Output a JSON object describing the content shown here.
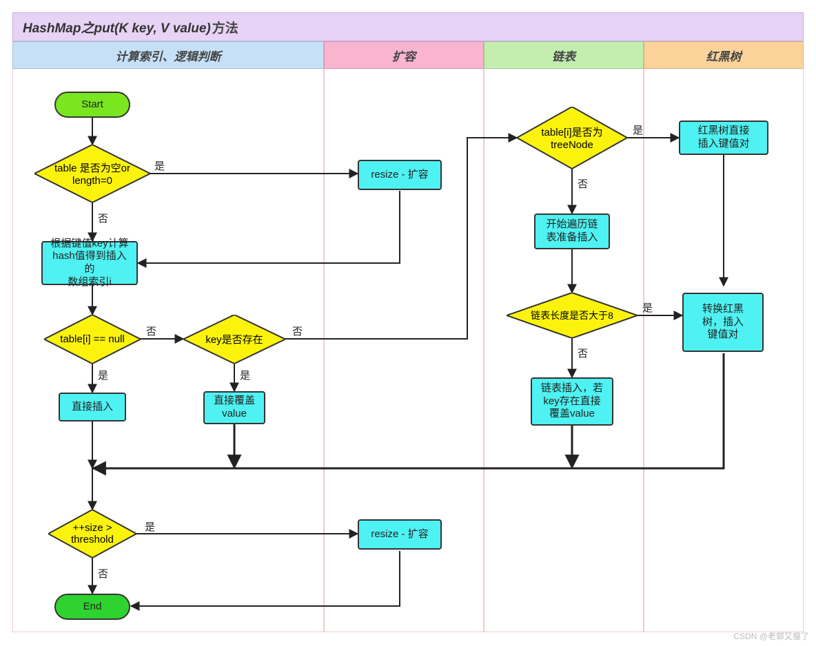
{
  "title_italic": "HashMap之put(K key, V value)",
  "title_rest": "方法",
  "lanes": {
    "l1": "计算索引、逻辑判断",
    "l2": "扩容",
    "l3": "链表",
    "l4": "红黑树"
  },
  "nodes": {
    "start": "Start",
    "end": "End",
    "d_table_empty": "table 是否为空or\nlength=0",
    "p_calc_hash": "根据键值key计算\nhash值得到插入的\n数组索引i",
    "d_table_i_null": "table[i] == null",
    "d_key_exists": "key是否存在",
    "p_direct_insert": "直接插入",
    "p_overwrite": "直接覆盖\nvalue",
    "d_size_threshold": "++size >\nthreshold",
    "p_resize1": "resize - 扩容",
    "p_resize2": "resize - 扩容",
    "d_is_treenode": "table[i]是否为\ntreeNode",
    "p_rbtree_insert": "红黑树直接\n插入键值对",
    "p_traverse_list": "开始遍历链\n表准备插入",
    "d_len_gt8": "链表长度是否大于8",
    "p_convert_rbtree": "转换红黑\n树，插入\n键值对",
    "p_list_insert": "链表插入，若\nkey存在直接\n覆盖value"
  },
  "edges": {
    "yes": "是",
    "no": "否"
  },
  "watermark": "CSDN @老郭又瘦了"
}
